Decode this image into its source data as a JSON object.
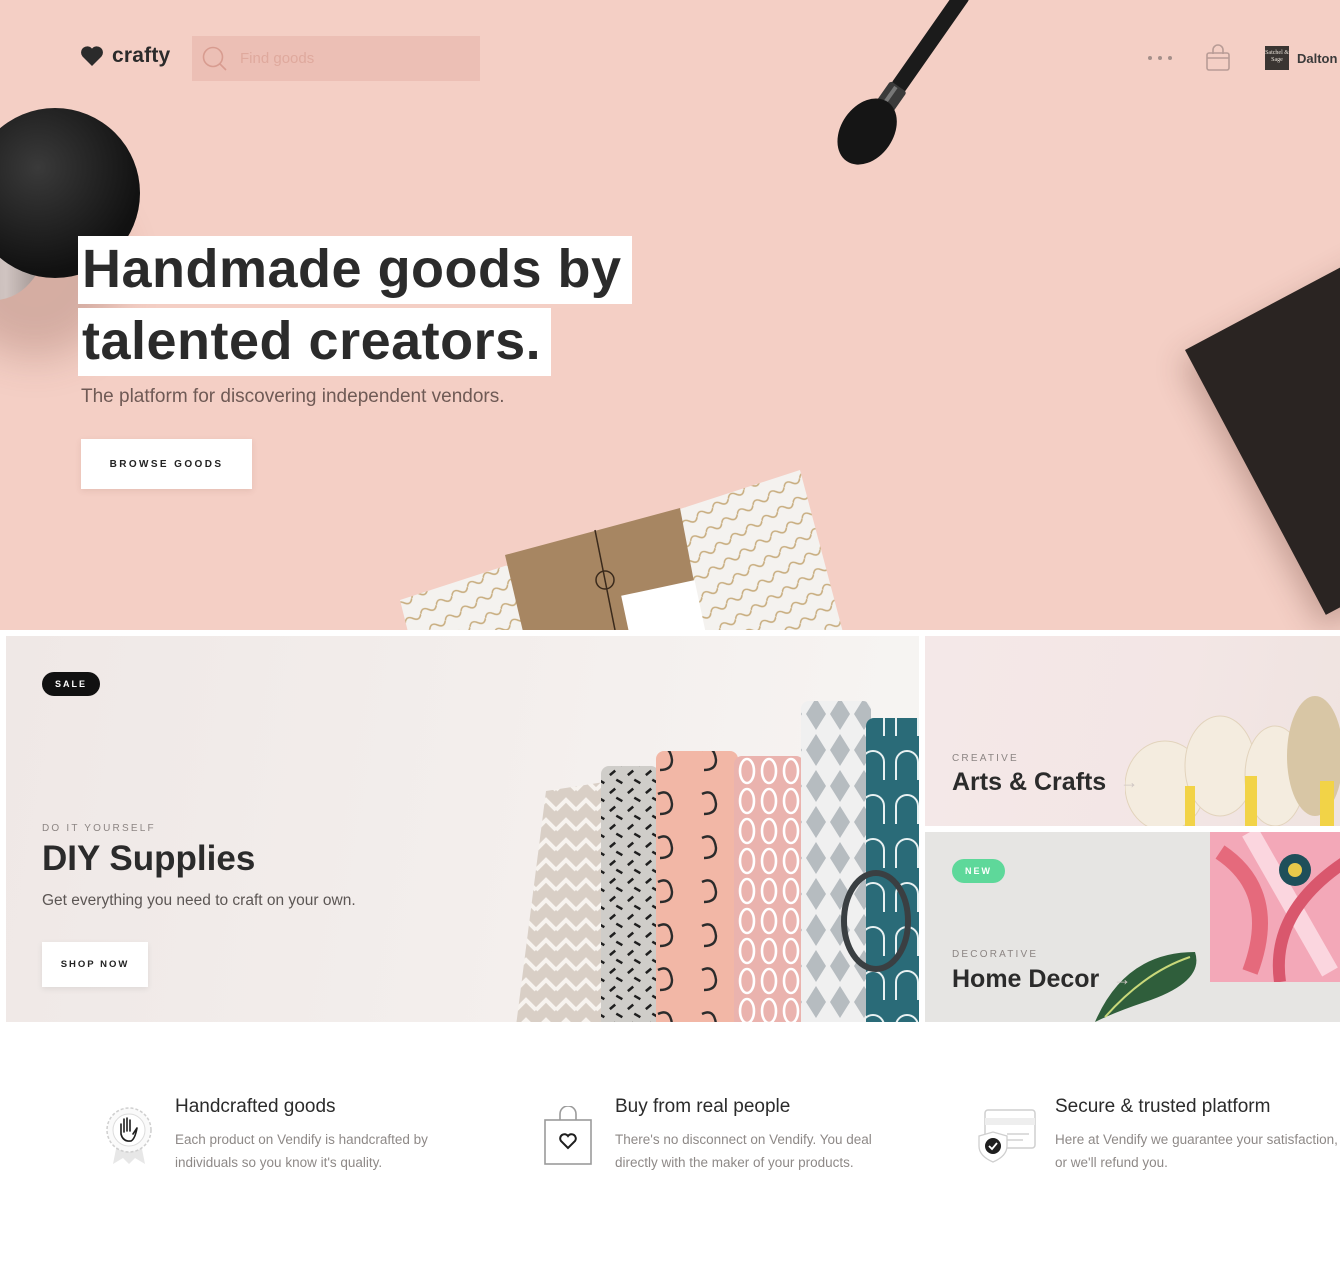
{
  "brand": {
    "name": "crafty"
  },
  "search": {
    "placeholder": "Find goods",
    "value": ""
  },
  "header": {
    "user_name": "Dalton",
    "avatar_text": "Satchel & Sage"
  },
  "hero": {
    "title_line1": "Handmade goods by",
    "title_line2": "talented creators.",
    "subtitle": "The platform for discovering independent vendors.",
    "cta_label": "BROWSE GOODS"
  },
  "promos": {
    "main": {
      "badge": "SALE",
      "eyebrow": "DO IT YOURSELF",
      "title": "DIY Supplies",
      "description": "Get everything you need to craft on your own.",
      "cta_label": "SHOP NOW"
    },
    "arts": {
      "eyebrow": "CREATIVE",
      "title": "Arts & Crafts",
      "arrow": "→"
    },
    "decor": {
      "badge": "NEW",
      "eyebrow": "DECORATIVE",
      "title": "Home Decor",
      "arrow": "→"
    }
  },
  "features": [
    {
      "icon": "ribbon-hand-icon",
      "title": "Handcrafted goods",
      "description": "Each product on Vendify is handcrafted by individuals so you know it's quality."
    },
    {
      "icon": "heart-bag-icon",
      "title": "Buy from real people",
      "description": "There's no disconnect on Vendify. You deal directly with the maker of your products."
    },
    {
      "icon": "secure-card-icon",
      "title": "Secure & trusted platform",
      "description": "Here at Vendify we guarantee your satisfaction, or we'll refund you."
    }
  ],
  "colors": {
    "hero_bg": "#f4cfc5",
    "search_bg": "#ecbfb5",
    "new_badge": "#5ed89a",
    "sale_badge": "#111111"
  }
}
